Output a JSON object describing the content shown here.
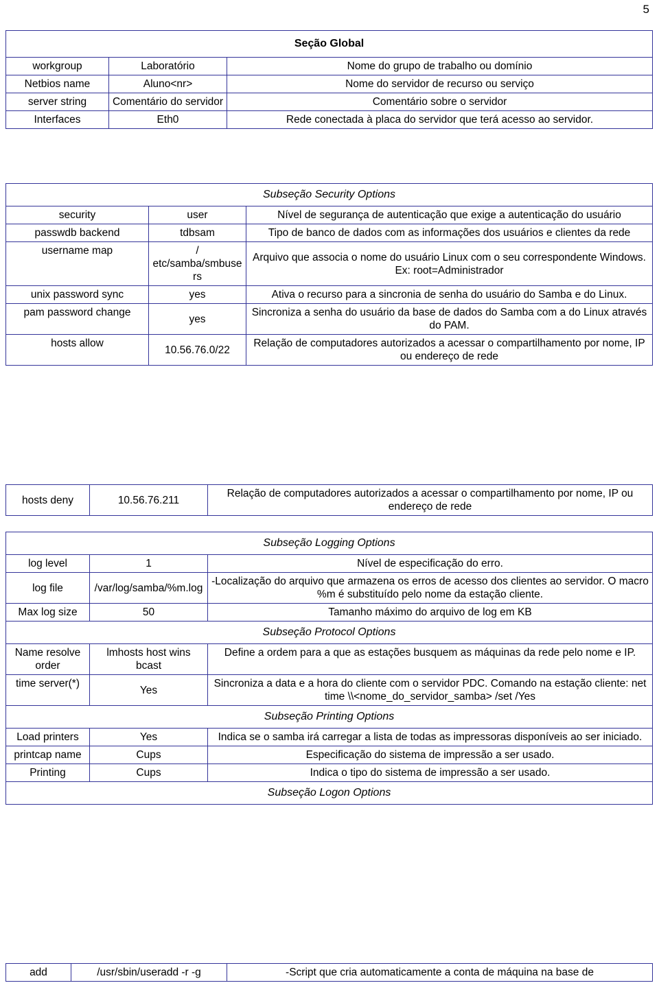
{
  "page": {
    "number": "5"
  },
  "table": {
    "section_title": "Seção Global",
    "global_rows": [
      {
        "key": "workgroup",
        "value": "Laboratório",
        "description": "Nome do grupo de trabalho ou domínio"
      },
      {
        "key": "Netbios name",
        "value": "Aluno<nr>",
        "description": "Nome do servidor de recurso ou serviço"
      },
      {
        "key": "server string",
        "value": "Comentário do servidor",
        "description": "Comentário sobre o servidor"
      },
      {
        "key": "Interfaces",
        "value": "Eth0",
        "description": "Rede conectada à placa do servidor que terá acesso ao servidor."
      }
    ],
    "security_subsection_title": "Subseção Security Options",
    "security_rows": [
      {
        "key": "security",
        "value": "user",
        "description": "Nível de segurança de autenticação que exige a autenticação do usuário"
      },
      {
        "key": "passwdb backend",
        "value": "tdbsam",
        "description": "Tipo de banco de dados com as informações dos usuários e clientes da rede"
      },
      {
        "key": "username map",
        "value": "/ etc/samba/smbusers",
        "description": "Arquivo que associa o nome do usuário Linux com o seu correspondente Windows. Ex: root=Administrador"
      },
      {
        "key": "unix password sync",
        "value": "yes",
        "description": "Ativa o recurso para a sincronia de senha do usuário do Samba e do Linux."
      },
      {
        "key": "pam password change",
        "value": "yes",
        "description": "Sincroniza a senha do usuário da base de dados do Samba com a do Linux através do PAM."
      },
      {
        "key": "hosts allow",
        "value": "10.56.76.0/22",
        "description": "Relação de computadores autorizados a acessar o compartilhamento por nome, IP ou endereço de rede"
      }
    ],
    "hosts_deny_row": {
      "key": "hosts deny",
      "value": "10.56.76.211",
      "description": "Relação de computadores autorizados a acessar o compartilhamento por nome, IP ou endereço de rede"
    },
    "logging_subsection_title": "Subseção Logging Options",
    "logging_rows": [
      {
        "key": "log level",
        "value": "1",
        "description": "Nível de especificação do erro."
      },
      {
        "key": "log file",
        "value": "/var/log/samba/%m.log",
        "description": "-Localização do arquivo que armazena os erros de acesso dos clientes ao servidor. O macro %m é substituído pelo nome da estação cliente."
      },
      {
        "key": "Max log size",
        "value": "50",
        "description": "Tamanho máximo do arquivo de log em KB"
      }
    ],
    "protocol_subsection_title": "Subseção Protocol Options",
    "protocol_rows": [
      {
        "key": "Name resolve order",
        "value": "lmhosts host wins bcast",
        "description": "Define a ordem para a que as estações busquem as máquinas da rede pelo nome e IP."
      },
      {
        "key": "time server(*)",
        "value": "Yes",
        "description": "Sincroniza a data e a hora do cliente com o servidor PDC. Comando na estação cliente: net time \\\\<nome_do_servidor_samba> /set /Yes"
      }
    ],
    "printing_subsection_title": "Subseção Printing Options",
    "printing_rows": [
      {
        "key": "Load printers",
        "value": "Yes",
        "description": "Indica se o samba irá carregar a lista de todas as impressoras disponíveis ao ser iniciado."
      },
      {
        "key": "printcap name",
        "value": "Cups",
        "description": "Especificação do sistema de impressão a ser usado."
      },
      {
        "key": "Printing",
        "value": "Cups",
        "description": "Indica o tipo do sistema de impressão a ser usado."
      }
    ],
    "logon_subsection_title": "Subseção Logon Options",
    "logon_rows": [
      {
        "key": "add",
        "value": "/usr/sbin/useradd  -r -g",
        "description": "-Script que cria automaticamente a conta de máquina na base de"
      }
    ]
  },
  "colors": {
    "border": "#333399",
    "text": "#000000",
    "background": "#ffffff"
  }
}
